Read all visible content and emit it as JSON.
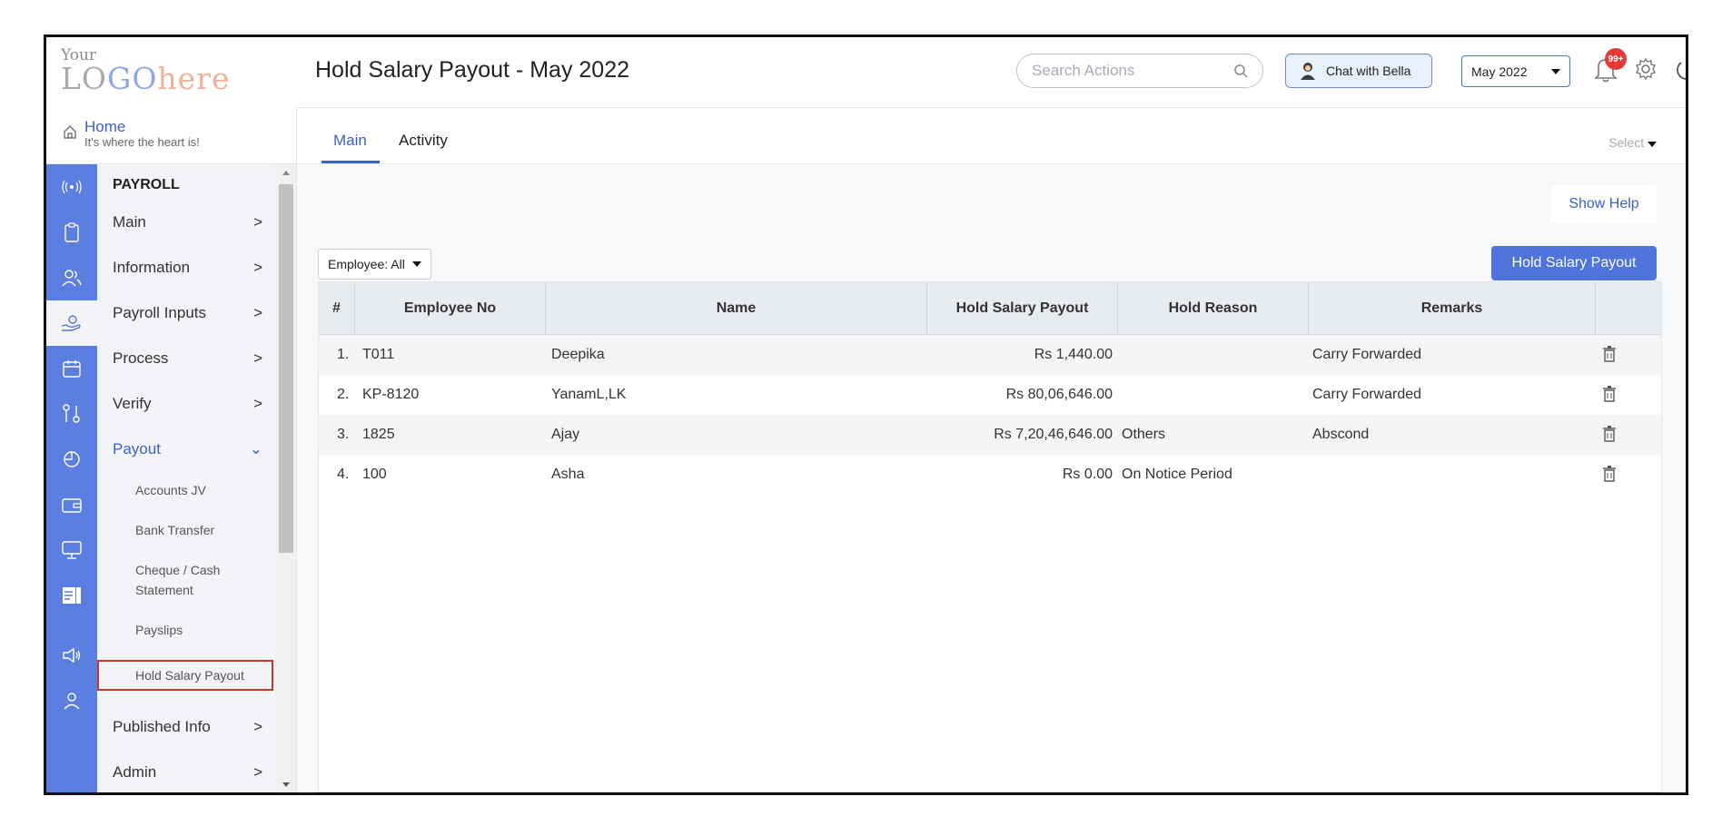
{
  "logo": {
    "your": "Your",
    "lo": "LO",
    "go": "GO",
    "here": "here"
  },
  "header": {
    "title": "Hold Salary Payout - May 2022",
    "search_placeholder": "Search Actions",
    "chat_label": "Chat with Bella",
    "month": "May 2022",
    "notif_badge": "99+"
  },
  "home": {
    "title": "Home",
    "subtitle": "It's where the heart is!"
  },
  "sidebar": {
    "section": "PAYROLL",
    "items": [
      {
        "label": "Main",
        "chevron": ">"
      },
      {
        "label": "Information",
        "chevron": ">"
      },
      {
        "label": "Payroll Inputs",
        "chevron": ">"
      },
      {
        "label": "Process",
        "chevron": ">"
      },
      {
        "label": "Verify",
        "chevron": ">"
      },
      {
        "label": "Payout",
        "chevron": "⌄"
      },
      {
        "label": "Published Info",
        "chevron": ">"
      },
      {
        "label": "Admin",
        "chevron": ">"
      }
    ],
    "payout_sub": [
      "Accounts JV",
      "Bank Transfer",
      "Cheque / Cash Statement",
      "Payslips",
      "Hold Salary Payout"
    ]
  },
  "tabs": {
    "main": "Main",
    "activity": "Activity",
    "select": "Select"
  },
  "toolbar": {
    "show_help": "Show Help",
    "hold_salary_payout": "Hold Salary Payout",
    "employee_filter": "Employee: All"
  },
  "table": {
    "columns": [
      "#",
      "Employee No",
      "Name",
      "Hold Salary Payout",
      "Hold Reason",
      "Remarks"
    ],
    "rows": [
      {
        "num": "1.",
        "emp_no": "T011",
        "name": "Deepika",
        "payout": "Rs 1,440.00",
        "reason": "",
        "remarks": "Carry Forwarded"
      },
      {
        "num": "2.",
        "emp_no": "KP-8120",
        "name": "YanamL,LK",
        "payout": "Rs 80,06,646.00",
        "reason": "",
        "remarks": "Carry Forwarded"
      },
      {
        "num": "3.",
        "emp_no": "1825",
        "name": "Ajay",
        "payout": "Rs 7,20,46,646.00",
        "reason": "Others",
        "remarks": "Abscond"
      },
      {
        "num": "4.",
        "emp_no": "100",
        "name": "Asha",
        "payout": "Rs 0.00",
        "reason": "On Notice Period",
        "remarks": ""
      }
    ]
  },
  "colors": {
    "accent": "#4f74dc",
    "rail": "#5a7fe0",
    "selection": "#c0392b",
    "badge": "#e53935"
  }
}
